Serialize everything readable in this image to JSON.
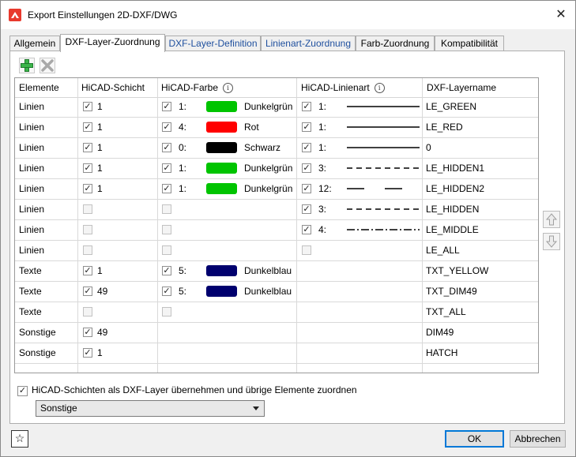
{
  "window": {
    "title": "Export Einstellungen 2D-DXF/DWG",
    "close_glyph": "✕"
  },
  "tabs": [
    {
      "label": "Allgemein"
    },
    {
      "label": "DXF-Layer-Zuordnung"
    },
    {
      "label": "DXF-Layer-Definition"
    },
    {
      "label": "Linienart-Zuordnung"
    },
    {
      "label": "Farb-Zuordnung"
    },
    {
      "label": "Kompatibilität"
    }
  ],
  "toolbar": {
    "add_icon": "plus-icon",
    "delete_icon": "cross-icon"
  },
  "table": {
    "headers": {
      "elemente": "Elemente",
      "schicht": "HiCAD-Schicht",
      "farbe": "HiCAD-Farbe",
      "linienart": "HiCAD-Linienart",
      "layername": "DXF-Layername",
      "info_glyph": "i"
    },
    "check_glyph": "✓",
    "rows": [
      {
        "element": "Linien",
        "schicht_checked": true,
        "schicht": "1",
        "farbe_checked": true,
        "farbe_nr": "1:",
        "farbe_color": "#00c400",
        "farbe_name": "Dunkelgrün",
        "linie_checked": true,
        "linie_nr": "1:",
        "linie_style": "solid",
        "layer": "LE_GREEN"
      },
      {
        "element": "Linien",
        "schicht_checked": true,
        "schicht": "1",
        "farbe_checked": true,
        "farbe_nr": "4:",
        "farbe_color": "#ff0000",
        "farbe_name": "Rot",
        "linie_checked": true,
        "linie_nr": "1:",
        "linie_style": "solid",
        "layer": "LE_RED"
      },
      {
        "element": "Linien",
        "schicht_checked": true,
        "schicht": "1",
        "farbe_checked": true,
        "farbe_nr": "0:",
        "farbe_color": "#000000",
        "farbe_name": "Schwarz",
        "linie_checked": true,
        "linie_nr": "1:",
        "linie_style": "solid",
        "layer": "0"
      },
      {
        "element": "Linien",
        "schicht_checked": true,
        "schicht": "1",
        "farbe_checked": true,
        "farbe_nr": "1:",
        "farbe_color": "#00c400",
        "farbe_name": "Dunkelgrün",
        "linie_checked": true,
        "linie_nr": "3:",
        "linie_style": "dashed",
        "layer": "LE_HIDDEN1"
      },
      {
        "element": "Linien",
        "schicht_checked": true,
        "schicht": "1",
        "farbe_checked": true,
        "farbe_nr": "1:",
        "farbe_color": "#00c400",
        "farbe_name": "Dunkelgrün",
        "linie_checked": true,
        "linie_nr": "12:",
        "linie_style": "longdash",
        "layer": "LE_HIDDEN2"
      },
      {
        "element": "Linien",
        "schicht_checked": false,
        "schicht": "",
        "farbe_checked": false,
        "farbe_nr": "",
        "farbe_color": "",
        "farbe_name": "",
        "linie_checked": true,
        "linie_nr": "3:",
        "linie_style": "dashed",
        "layer": "LE_HIDDEN"
      },
      {
        "element": "Linien",
        "schicht_checked": false,
        "schicht": "",
        "farbe_checked": false,
        "farbe_nr": "",
        "farbe_color": "",
        "farbe_name": "",
        "linie_checked": true,
        "linie_nr": "4:",
        "linie_style": "dashdot",
        "layer": "LE_MIDDLE"
      },
      {
        "element": "Linien",
        "schicht_checked": false,
        "schicht": "",
        "farbe_checked": false,
        "farbe_nr": "",
        "farbe_color": "",
        "farbe_name": "",
        "linie_checked": false,
        "linie_nr": "",
        "linie_style": "",
        "layer": "LE_ALL"
      },
      {
        "element": "Texte",
        "schicht_checked": true,
        "schicht": "1",
        "farbe_checked": true,
        "farbe_nr": "5:",
        "farbe_color": "#00006e",
        "farbe_name": "Dunkelblau",
        "linie_checked": null,
        "linie_nr": "",
        "linie_style": "",
        "layer": "TXT_YELLOW"
      },
      {
        "element": "Texte",
        "schicht_checked": true,
        "schicht": "49",
        "farbe_checked": true,
        "farbe_nr": "5:",
        "farbe_color": "#00006e",
        "farbe_name": "Dunkelblau",
        "linie_checked": null,
        "linie_nr": "",
        "linie_style": "",
        "layer": "TXT_DIM49"
      },
      {
        "element": "Texte",
        "schicht_checked": false,
        "schicht": "",
        "farbe_checked": false,
        "farbe_nr": "",
        "farbe_color": "",
        "farbe_name": "",
        "linie_checked": null,
        "linie_nr": "",
        "linie_style": "",
        "layer": "TXT_ALL"
      },
      {
        "element": "Sonstige",
        "schicht_checked": true,
        "schicht": "49",
        "farbe_checked": null,
        "farbe_nr": "",
        "farbe_color": "",
        "farbe_name": "",
        "linie_checked": null,
        "linie_nr": "",
        "linie_style": "",
        "layer": "DIM49"
      },
      {
        "element": "Sonstige",
        "schicht_checked": true,
        "schicht": "1",
        "farbe_checked": null,
        "farbe_nr": "",
        "farbe_color": "",
        "farbe_name": "",
        "linie_checked": null,
        "linie_nr": "",
        "linie_style": "",
        "layer": "HATCH"
      }
    ]
  },
  "side_buttons": {
    "up_icon": "arrow-up-icon",
    "down_icon": "arrow-down-icon"
  },
  "option": {
    "checked": true,
    "label": "HiCAD-Schichten als DXF-Layer übernehmen und übrige Elemente zuordnen"
  },
  "select": {
    "value": "Sonstige"
  },
  "footer": {
    "star_glyph": "☆",
    "ok_label": "OK",
    "cancel_label": "Abbrechen"
  }
}
